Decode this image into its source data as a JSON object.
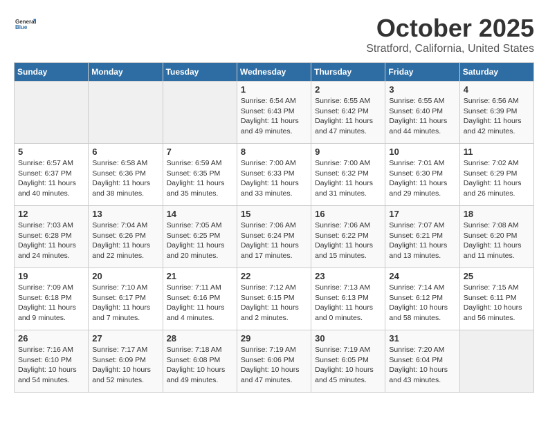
{
  "header": {
    "logo_line1": "General",
    "logo_line2": "Blue",
    "month": "October 2025",
    "location": "Stratford, California, United States"
  },
  "days_of_week": [
    "Sunday",
    "Monday",
    "Tuesday",
    "Wednesday",
    "Thursday",
    "Friday",
    "Saturday"
  ],
  "weeks": [
    [
      {
        "day": "",
        "info": ""
      },
      {
        "day": "",
        "info": ""
      },
      {
        "day": "",
        "info": ""
      },
      {
        "day": "1",
        "info": "Sunrise: 6:54 AM\nSunset: 6:43 PM\nDaylight: 11 hours\nand 49 minutes."
      },
      {
        "day": "2",
        "info": "Sunrise: 6:55 AM\nSunset: 6:42 PM\nDaylight: 11 hours\nand 47 minutes."
      },
      {
        "day": "3",
        "info": "Sunrise: 6:55 AM\nSunset: 6:40 PM\nDaylight: 11 hours\nand 44 minutes."
      },
      {
        "day": "4",
        "info": "Sunrise: 6:56 AM\nSunset: 6:39 PM\nDaylight: 11 hours\nand 42 minutes."
      }
    ],
    [
      {
        "day": "5",
        "info": "Sunrise: 6:57 AM\nSunset: 6:37 PM\nDaylight: 11 hours\nand 40 minutes."
      },
      {
        "day": "6",
        "info": "Sunrise: 6:58 AM\nSunset: 6:36 PM\nDaylight: 11 hours\nand 38 minutes."
      },
      {
        "day": "7",
        "info": "Sunrise: 6:59 AM\nSunset: 6:35 PM\nDaylight: 11 hours\nand 35 minutes."
      },
      {
        "day": "8",
        "info": "Sunrise: 7:00 AM\nSunset: 6:33 PM\nDaylight: 11 hours\nand 33 minutes."
      },
      {
        "day": "9",
        "info": "Sunrise: 7:00 AM\nSunset: 6:32 PM\nDaylight: 11 hours\nand 31 minutes."
      },
      {
        "day": "10",
        "info": "Sunrise: 7:01 AM\nSunset: 6:30 PM\nDaylight: 11 hours\nand 29 minutes."
      },
      {
        "day": "11",
        "info": "Sunrise: 7:02 AM\nSunset: 6:29 PM\nDaylight: 11 hours\nand 26 minutes."
      }
    ],
    [
      {
        "day": "12",
        "info": "Sunrise: 7:03 AM\nSunset: 6:28 PM\nDaylight: 11 hours\nand 24 minutes."
      },
      {
        "day": "13",
        "info": "Sunrise: 7:04 AM\nSunset: 6:26 PM\nDaylight: 11 hours\nand 22 minutes."
      },
      {
        "day": "14",
        "info": "Sunrise: 7:05 AM\nSunset: 6:25 PM\nDaylight: 11 hours\nand 20 minutes."
      },
      {
        "day": "15",
        "info": "Sunrise: 7:06 AM\nSunset: 6:24 PM\nDaylight: 11 hours\nand 17 minutes."
      },
      {
        "day": "16",
        "info": "Sunrise: 7:06 AM\nSunset: 6:22 PM\nDaylight: 11 hours\nand 15 minutes."
      },
      {
        "day": "17",
        "info": "Sunrise: 7:07 AM\nSunset: 6:21 PM\nDaylight: 11 hours\nand 13 minutes."
      },
      {
        "day": "18",
        "info": "Sunrise: 7:08 AM\nSunset: 6:20 PM\nDaylight: 11 hours\nand 11 minutes."
      }
    ],
    [
      {
        "day": "19",
        "info": "Sunrise: 7:09 AM\nSunset: 6:18 PM\nDaylight: 11 hours\nand 9 minutes."
      },
      {
        "day": "20",
        "info": "Sunrise: 7:10 AM\nSunset: 6:17 PM\nDaylight: 11 hours\nand 7 minutes."
      },
      {
        "day": "21",
        "info": "Sunrise: 7:11 AM\nSunset: 6:16 PM\nDaylight: 11 hours\nand 4 minutes."
      },
      {
        "day": "22",
        "info": "Sunrise: 7:12 AM\nSunset: 6:15 PM\nDaylight: 11 hours\nand 2 minutes."
      },
      {
        "day": "23",
        "info": "Sunrise: 7:13 AM\nSunset: 6:13 PM\nDaylight: 11 hours\nand 0 minutes."
      },
      {
        "day": "24",
        "info": "Sunrise: 7:14 AM\nSunset: 6:12 PM\nDaylight: 10 hours\nand 58 minutes."
      },
      {
        "day": "25",
        "info": "Sunrise: 7:15 AM\nSunset: 6:11 PM\nDaylight: 10 hours\nand 56 minutes."
      }
    ],
    [
      {
        "day": "26",
        "info": "Sunrise: 7:16 AM\nSunset: 6:10 PM\nDaylight: 10 hours\nand 54 minutes."
      },
      {
        "day": "27",
        "info": "Sunrise: 7:17 AM\nSunset: 6:09 PM\nDaylight: 10 hours\nand 52 minutes."
      },
      {
        "day": "28",
        "info": "Sunrise: 7:18 AM\nSunset: 6:08 PM\nDaylight: 10 hours\nand 49 minutes."
      },
      {
        "day": "29",
        "info": "Sunrise: 7:19 AM\nSunset: 6:06 PM\nDaylight: 10 hours\nand 47 minutes."
      },
      {
        "day": "30",
        "info": "Sunrise: 7:19 AM\nSunset: 6:05 PM\nDaylight: 10 hours\nand 45 minutes."
      },
      {
        "day": "31",
        "info": "Sunrise: 7:20 AM\nSunset: 6:04 PM\nDaylight: 10 hours\nand 43 minutes."
      },
      {
        "day": "",
        "info": ""
      }
    ]
  ]
}
